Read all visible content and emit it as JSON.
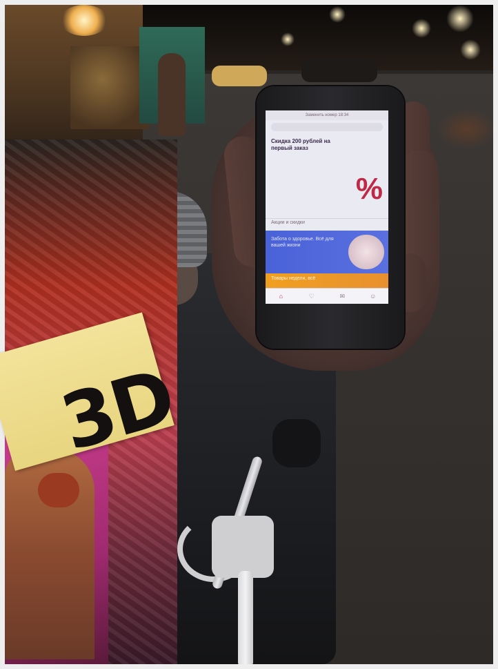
{
  "photo": {
    "description_kind": "night street photo, hand holding smartphone, yellow card",
    "sign_text": "3D"
  },
  "phone_screen": {
    "status_text": "Заменить номер 18:34",
    "search_placeholder": "",
    "promo_title": "Скидка 200 рублей на первый заказ",
    "promo_symbol": "%",
    "section_title": "Акции и скидки",
    "banner_blue_text": "Забота о здоровье. Всё для вашей жизни",
    "banner_orange_text": "Товары недели, всё",
    "tabs": [
      "home-icon",
      "heart-icon",
      "chat-icon",
      "profile-icon"
    ],
    "colors": {
      "accent": "#c02848",
      "banner_blue": "#4a62d8",
      "banner_orange": "#f0a020"
    }
  }
}
